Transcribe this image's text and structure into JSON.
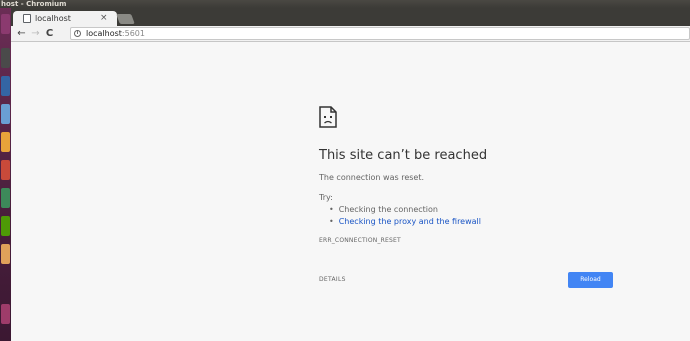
{
  "window": {
    "title": "host - Chromium"
  },
  "launcher": {
    "icons": [
      {
        "name": "launcher-app-icon-1",
        "color": "#8b3a6f"
      },
      {
        "name": "launcher-app-icon-2",
        "color": "#4a4a4a"
      },
      {
        "name": "launcher-app-icon-3",
        "color": "#3465a4"
      },
      {
        "name": "launcher-app-icon-4",
        "color": "#6a9fd4"
      },
      {
        "name": "launcher-app-icon-5",
        "color": "#e8a33a"
      },
      {
        "name": "launcher-app-icon-6",
        "color": "#c94a3a"
      },
      {
        "name": "launcher-app-icon-7",
        "color": "#3d8a5a"
      },
      {
        "name": "launcher-app-icon-8",
        "color": "#4e9a06"
      },
      {
        "name": "launcher-app-icon-9",
        "color": "#e0a15a"
      },
      {
        "name": "launcher-app-icon-10",
        "color": "#9e3c6a"
      }
    ]
  },
  "tabs": [
    {
      "title": "localhost",
      "close": "×"
    }
  ],
  "toolbar": {
    "back": "←",
    "forward": "→",
    "reload": "C",
    "info_icon": "i",
    "url_host": "localhost",
    "url_port": ":5601"
  },
  "error": {
    "title": "This site can’t be reached",
    "description": "The connection was reset.",
    "try_label": "Try:",
    "suggestions": [
      {
        "text": "Checking the connection",
        "link": false
      },
      {
        "text": "Checking the proxy and the firewall",
        "link": true
      }
    ],
    "code": "ERR_CONNECTION_RESET",
    "details_label": "DETAILS",
    "reload_label": "Reload",
    "accent_color": "#4285f4",
    "link_color": "#1a55c5"
  }
}
